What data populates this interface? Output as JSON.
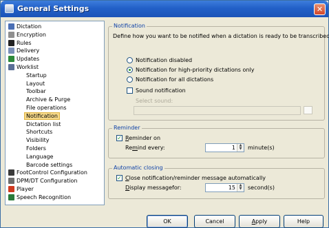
{
  "window": {
    "title": "General Settings",
    "close_glyph": "✕"
  },
  "tree": [
    {
      "label": "Dictation",
      "icon": "dictation-icon",
      "color": "#4a6fb5",
      "indent": 0
    },
    {
      "label": "Encryption",
      "icon": "encryption-icon",
      "color": "#8f8f8f",
      "indent": 0
    },
    {
      "label": "Rules",
      "icon": "rules-icon",
      "color": "#222222",
      "indent": 0
    },
    {
      "label": "Delivery",
      "icon": "delivery-icon",
      "color": "#7a90b8",
      "indent": 0
    },
    {
      "label": "Updates",
      "icon": "updates-icon",
      "color": "#2d8a3a",
      "indent": 0
    },
    {
      "label": "Worklist",
      "icon": "worklist-icon",
      "color": "#5a6f96",
      "indent": 0
    },
    {
      "label": "Startup",
      "indent": 1
    },
    {
      "label": "Layout",
      "indent": 1
    },
    {
      "label": "Toolbar",
      "indent": 1
    },
    {
      "label": "Archive & Purge",
      "indent": 1
    },
    {
      "label": "File operations",
      "indent": 1
    },
    {
      "label": "Notification",
      "indent": 1,
      "selected": true
    },
    {
      "label": "Dictation list",
      "indent": 1
    },
    {
      "label": "Shortcuts",
      "indent": 1
    },
    {
      "label": "Visibility",
      "indent": 1
    },
    {
      "label": "Folders",
      "indent": 1
    },
    {
      "label": "Language",
      "indent": 1
    },
    {
      "label": "Barcode settings",
      "indent": 1
    },
    {
      "label": "FootControl Configuration",
      "icon": "footcontrol-icon",
      "color": "#3a3a3a",
      "indent": 0
    },
    {
      "label": "DPM/DT Configuration",
      "icon": "dpm-icon",
      "color": "#6d6d6d",
      "indent": 0
    },
    {
      "label": "Player",
      "icon": "player-icon",
      "color": "#d03a20",
      "indent": 0
    },
    {
      "label": "Speech Recognition",
      "icon": "speech-recognition-icon",
      "color": "#2a7a3a",
      "indent": 0
    }
  ],
  "notification": {
    "legend": "Notification",
    "description": "Define how you want to be notified when a dictation is ready to be transcribed.",
    "options": [
      {
        "label": "Notification disabled",
        "selected": false
      },
      {
        "label": "Notification for high-priority dictations only",
        "selected": true
      },
      {
        "label": "Notification for all dictations",
        "selected": false
      }
    ],
    "sound_label": "Sound notification",
    "sound_checked": false,
    "select_sound_label": "Select sound:",
    "sound_path": ""
  },
  "reminder": {
    "legend": "Reminder",
    "reminder_on_label": "Reminder on",
    "reminder_on_checked": true,
    "remind_every_label": "Remind every:",
    "remind_every_value": "1",
    "unit": "minute(s)"
  },
  "closing": {
    "legend": "Automatic closing",
    "close_label": "Close notification/reminder message automatically",
    "close_checked": true,
    "display_label": "Display message for:",
    "display_value": "15",
    "unit": "second(s)"
  },
  "buttons": {
    "ok": "OK",
    "cancel": "Cancel",
    "apply": "Apply",
    "help": "Help"
  }
}
